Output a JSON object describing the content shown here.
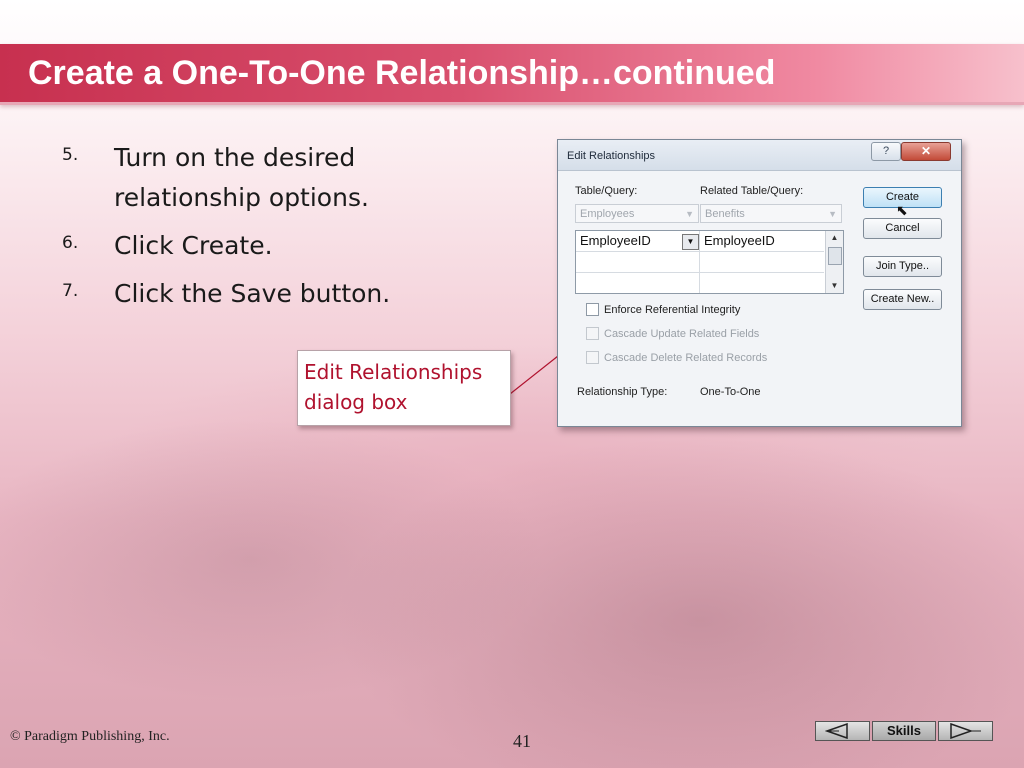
{
  "slide": {
    "title": "Create a One-To-One Relationship…continued",
    "steps": [
      {
        "number": "5.",
        "text": "Turn on the desired relationship options."
      },
      {
        "number": "6.",
        "text": "Click Create."
      },
      {
        "number": "7.",
        "text": "Click the Save button."
      }
    ],
    "callout": "Edit Relationships dialog box"
  },
  "dialog": {
    "title": "Edit Relationships",
    "help_label": "?",
    "close_label": "✕",
    "table_query_label": "Table/Query:",
    "related_table_query_label": "Related Table/Query:",
    "table_value": "Employees",
    "related_value": "Benefits",
    "grid": {
      "left_field": "EmployeeID",
      "right_field": "EmployeeID"
    },
    "checkboxes": [
      {
        "label": "Enforce Referential Integrity",
        "checked": false,
        "enabled": true
      },
      {
        "label": "Cascade Update Related Fields",
        "checked": false,
        "enabled": false
      },
      {
        "label": "Cascade Delete Related Records",
        "checked": false,
        "enabled": false
      }
    ],
    "relationship_type_label": "Relationship Type:",
    "relationship_type_value": "One-To-One",
    "buttons": {
      "create": "Create",
      "cancel": "Cancel",
      "join_type": "Join Type..",
      "create_new": "Create New.."
    }
  },
  "footer": {
    "copyright": "© Paradigm Publishing, Inc.",
    "page_number": "41",
    "nav_label": "Skills"
  },
  "colors": {
    "title_bar": "#d9506e",
    "callout_text": "#b0122e"
  }
}
